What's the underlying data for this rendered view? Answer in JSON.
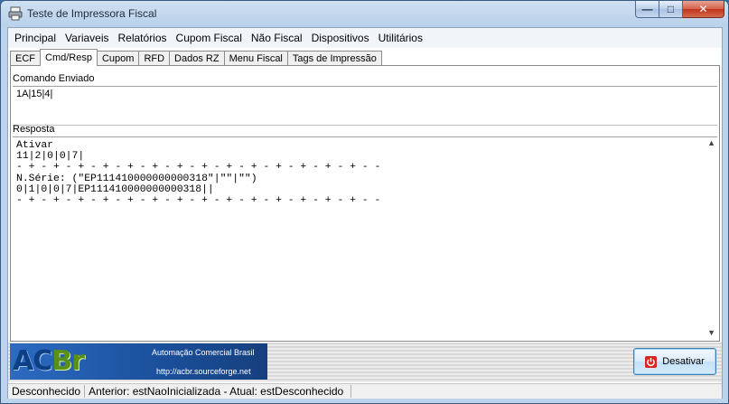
{
  "window": {
    "title": "Teste de Impressora Fiscal",
    "min_label": "—",
    "max_label": "□",
    "close_label": "✕"
  },
  "menu": [
    "Principal",
    "Variaveis",
    "Relatórios",
    "Cupom Fiscal",
    "Não Fiscal",
    "Dispositivos",
    "Utilitários"
  ],
  "tabs": [
    {
      "label": "ECF",
      "active": false
    },
    {
      "label": "Cmd/Resp",
      "active": true
    },
    {
      "label": "Cupom",
      "active": false
    },
    {
      "label": "RFD",
      "active": false
    },
    {
      "label": "Dados RZ",
      "active": false
    },
    {
      "label": "Menu Fiscal",
      "active": false
    },
    {
      "label": "Tags de Impressão",
      "active": false
    }
  ],
  "command": {
    "label": "Comando Enviado",
    "value": "1A|15|4|"
  },
  "response": {
    "label": "Resposta",
    "text": "Ativar\n11|2|0|0|7|\n- + - + - + - + - + - + - + - + - + - + - + - + - + - + - -\nN.Série: (\"EP111410000000000318\"|\"\"|\"\")\n0|1|0|0|7|EP111410000000000318||\n- + - + - + - + - + - + - + - + - + - + - + - + - + - + - -"
  },
  "banner": {
    "logo_a": "AC",
    "logo_b": "Br",
    "title": "Automação Comercial Brasil",
    "url": "http://acbr.sourceforge.net"
  },
  "desativar_label": "Desativar",
  "status": {
    "state": "Desconhecido",
    "transition": "Anterior: estNaoInicializada - Atual: estDesconhecido"
  },
  "colors": {
    "power_icon": "#d7261c",
    "banner_blue": "#1a4f9a"
  }
}
